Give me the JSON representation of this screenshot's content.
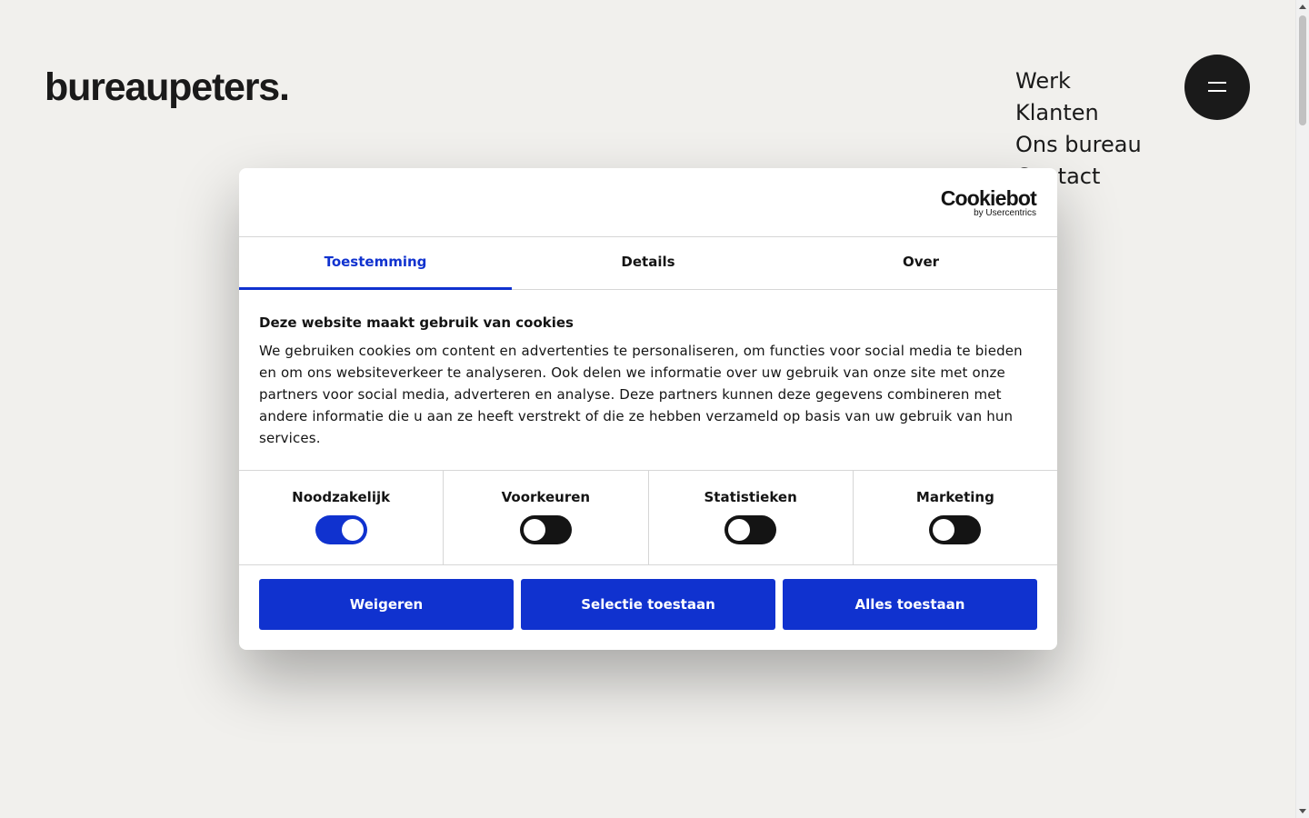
{
  "site": {
    "logo": "bureaupeters.",
    "nav": [
      "Werk",
      "Klanten",
      "Ons bureau",
      "Contact"
    ],
    "menu_button": "hamburger-menu"
  },
  "dialog": {
    "brand": {
      "name": "Cookiebot",
      "sub": "by Usercentrics"
    },
    "tabs": [
      {
        "label": "Toestemming",
        "active": true
      },
      {
        "label": "Details",
        "active": false
      },
      {
        "label": "Over",
        "active": false
      }
    ],
    "heading": "Deze website maakt gebruik van cookies",
    "text": "We gebruiken cookies om content en advertenties te personaliseren, om functies voor social media te bieden en om ons websiteverkeer te analyseren. Ook delen we informatie over uw gebruik van onze site met onze partners voor social media, adverteren en analyse. Deze partners kunnen deze gegevens combineren met andere informatie die u aan ze heeft verstrekt of die ze hebben verzameld op basis van uw gebruik van hun services.",
    "toggles": [
      {
        "label": "Noodzakelijk",
        "checked": true
      },
      {
        "label": "Voorkeuren",
        "checked": false
      },
      {
        "label": "Statistieken",
        "checked": false
      },
      {
        "label": "Marketing",
        "checked": false
      }
    ],
    "buttons": {
      "reject": "Weigeren",
      "selection": "Selectie toestaan",
      "allow_all": "Alles toestaan"
    }
  },
  "colors": {
    "accent": "#1032cf",
    "background": "#f1f0ed",
    "text": "#141414"
  }
}
